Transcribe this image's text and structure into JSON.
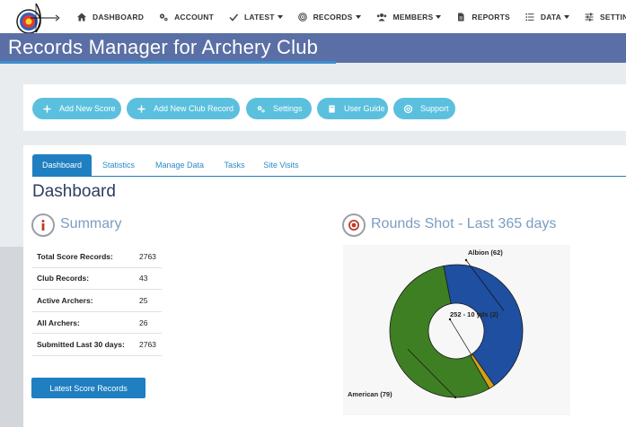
{
  "nav": {
    "items": [
      {
        "label": "DASHBOARD",
        "icon": "home-icon"
      },
      {
        "label": "ACCOUNT",
        "icon": "cogs-icon"
      },
      {
        "label": "LATEST",
        "icon": "check-icon",
        "dropdown": true
      },
      {
        "label": "RECORDS",
        "icon": "target-icon",
        "dropdown": true
      },
      {
        "label": "MEMBERS",
        "icon": "users-icon",
        "dropdown": true
      },
      {
        "label": "REPORTS",
        "icon": "file-icon"
      },
      {
        "label": "DATA",
        "icon": "list-icon",
        "dropdown": true
      },
      {
        "label": "SETTINGS",
        "icon": "sliders-icon"
      }
    ]
  },
  "banner": {
    "title": "Records Manager for Archery Club"
  },
  "actions": [
    {
      "label": "Add New Score",
      "icon": "plus-icon"
    },
    {
      "label": "Add New Club Record",
      "icon": "plus-icon"
    },
    {
      "label": "Settings",
      "icon": "cogs-icon"
    },
    {
      "label": "User Guide",
      "icon": "book-icon"
    },
    {
      "label": "Support",
      "icon": "lifebuoy-icon"
    }
  ],
  "tabs": [
    {
      "label": "Dashboard",
      "active": true
    },
    {
      "label": "Statistics",
      "active": false
    },
    {
      "label": "Manage Data",
      "active": false
    },
    {
      "label": "Tasks",
      "active": false
    },
    {
      "label": "Site Visits",
      "active": false
    }
  ],
  "page": {
    "title": "Dashboard"
  },
  "summary": {
    "title": "Summary",
    "rows": [
      {
        "label": "Total Score Records:",
        "value": "2763"
      },
      {
        "label": "Club Records:",
        "value": "43"
      },
      {
        "label": "Active Archers:",
        "value": "25"
      },
      {
        "label": "All Archers:",
        "value": "26"
      },
      {
        "label": "Submitted Last 30 days:",
        "value": "2763"
      }
    ],
    "button_label": "Latest Score Records"
  },
  "rounds": {
    "title": "Rounds Shot - Last 365 days"
  },
  "chart_data": {
    "type": "pie",
    "donut": true,
    "slices": [
      {
        "label": "Albion (62)",
        "value": 62,
        "color": "#1e4fa0"
      },
      {
        "label": "252 - 10 yds (2)",
        "value": 2,
        "color": "#d4a017"
      },
      {
        "label": "American (79)",
        "value": 79,
        "color": "#3f7f23"
      }
    ]
  },
  "colors": {
    "banner": "#5a6fa5",
    "pill": "#5bc0de",
    "primary": "#1f7fc0"
  }
}
